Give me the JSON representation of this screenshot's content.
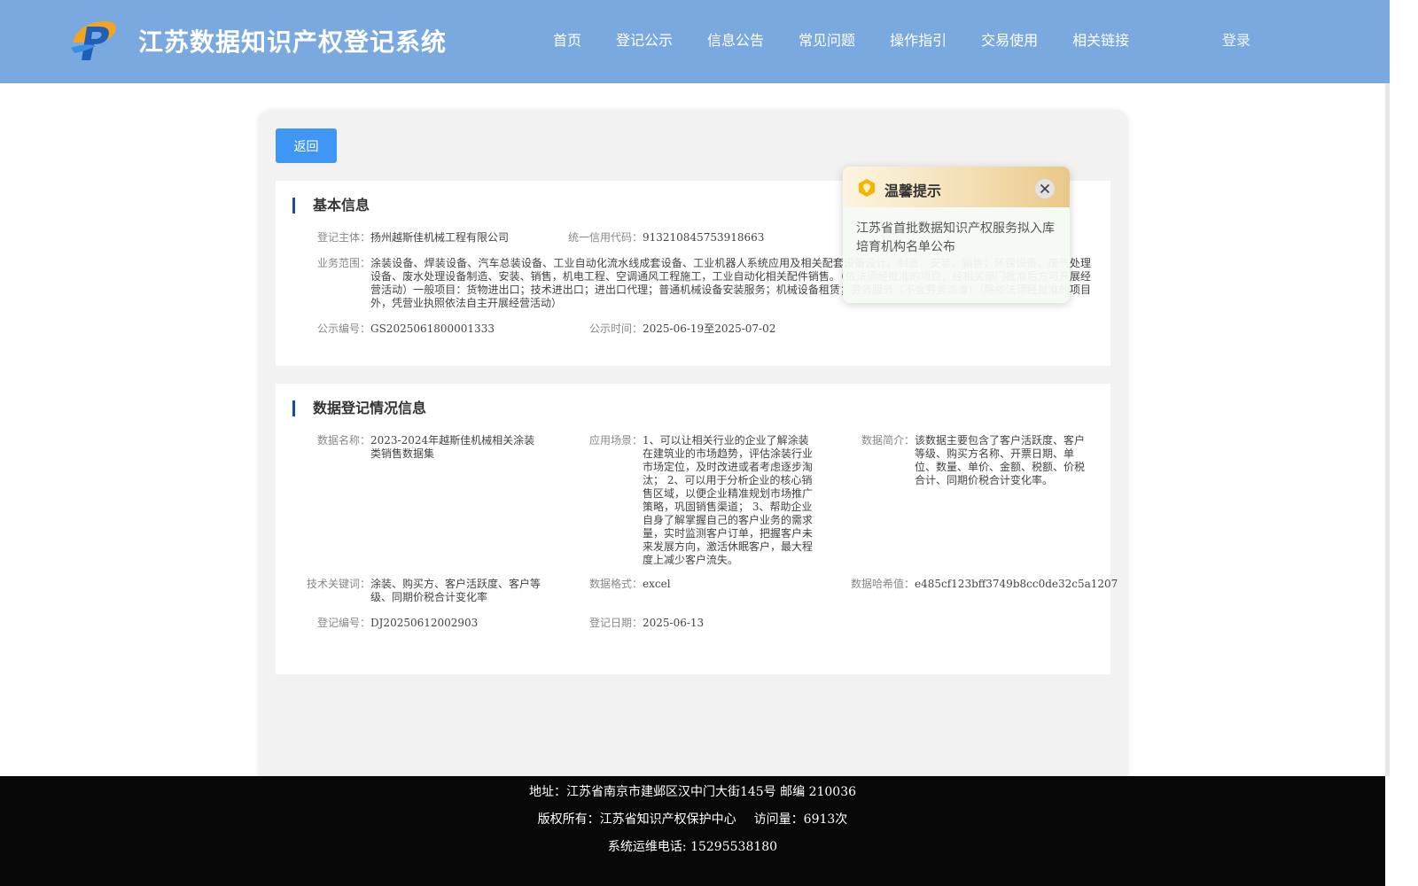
{
  "header": {
    "title": "江苏数据知识产权登记系统",
    "nav": [
      "首页",
      "登记公示",
      "信息公告",
      "常见问题",
      "操作指引",
      "交易使用",
      "相关链接"
    ],
    "login_label": "登录"
  },
  "back_label": "返回",
  "basic_info": {
    "heading": "基本信息",
    "subject_label": "登记主体：",
    "subject_value": "扬州越斯佳机械工程有限公司",
    "credit_code_label": "统一信用代码：",
    "credit_code_value": "91321084575391866З",
    "scope_label": "业务范围：",
    "scope_value": "涂装设备、焊装设备、汽车总装设备、工业自动化流水线成套设备、工业机器人系统应用及相关配套设备设计、制造、安装、销售；环保设备、废气处理设备、废水处理设备制造、安装、销售，机电工程、空调通风工程施工，工业自动化相关配件销售。（依法须经批准的项目，经相关部门批准后方可开展经营活动）一般项目：货物进出口；技术进出口；进出口代理；普通机械设备安装服务；机械设备租赁；劳务服务（不含劳务派遣）（除依法须经批准的项目外，凭营业执照依法自主开展经营活动）",
    "notice_no_label": "公示编号：",
    "notice_no_value": "GS2025061800001333",
    "notice_time_label": "公示时间：",
    "notice_time_value": "2025-06-19至2025-07-02"
  },
  "data_info": {
    "heading": "数据登记情况信息",
    "name_label": "数据名称：",
    "name_value": "2023-2024年越斯佳机械相关涂装类销售数据集",
    "scenario_label": "应用场景：",
    "scenario_value": "1、可以让相关行业的企业了解涂装在建筑业的市场趋势，评估涂装行业市场定位，及时改进或者考虑逐步淘汰； 2、可以用于分析企业的核心销售区域，以便企业精准规划市场推广策略，巩固销售渠道； 3、帮助企业自身了解掌握自己的客户业务的需求量，实时监测客户订单，把握客户未来发展方向，激活休眠客户，最大程度上减少客户流失。",
    "summary_label": "数据简介：",
    "summary_value": "该数据主要包含了客户活跃度、客户等级、购买方名称、开票日期、单位、数量、单价、金额、税额、价税合计、同期价税合计变化率。",
    "keywords_label": "技术关键词：",
    "keywords_value": "涂装、购买方、客户活跃度、客户等级、同期价税合计变化率",
    "format_label": "数据格式：",
    "format_value": "excel",
    "hash_label": "数据哈希值：",
    "hash_value": "e485cf123bff3749b8cc0de32c5a1207",
    "reg_no_label": "登记编号：",
    "reg_no_value": "DJ20250612002903",
    "reg_date_label": "登记日期：",
    "reg_date_value": "2025-06-13"
  },
  "toast": {
    "title": "温馨提示",
    "message": "江苏省首批数据知识产权服务拟入库培育机构名单公布"
  },
  "footer": {
    "address": "地址：江苏省南京市建邺区汉中门大街145号 邮编 210036",
    "copyright": "版权所有：江苏省知识产权保护中心",
    "visits": "访问量：6913次",
    "phone": "系统运维电话: 15295538180"
  },
  "colors": {
    "header_bg": "#7aa9df",
    "button_blue": "#3f96f5",
    "heading_bar": "#1a4e94",
    "footer_bg": "#080808"
  }
}
